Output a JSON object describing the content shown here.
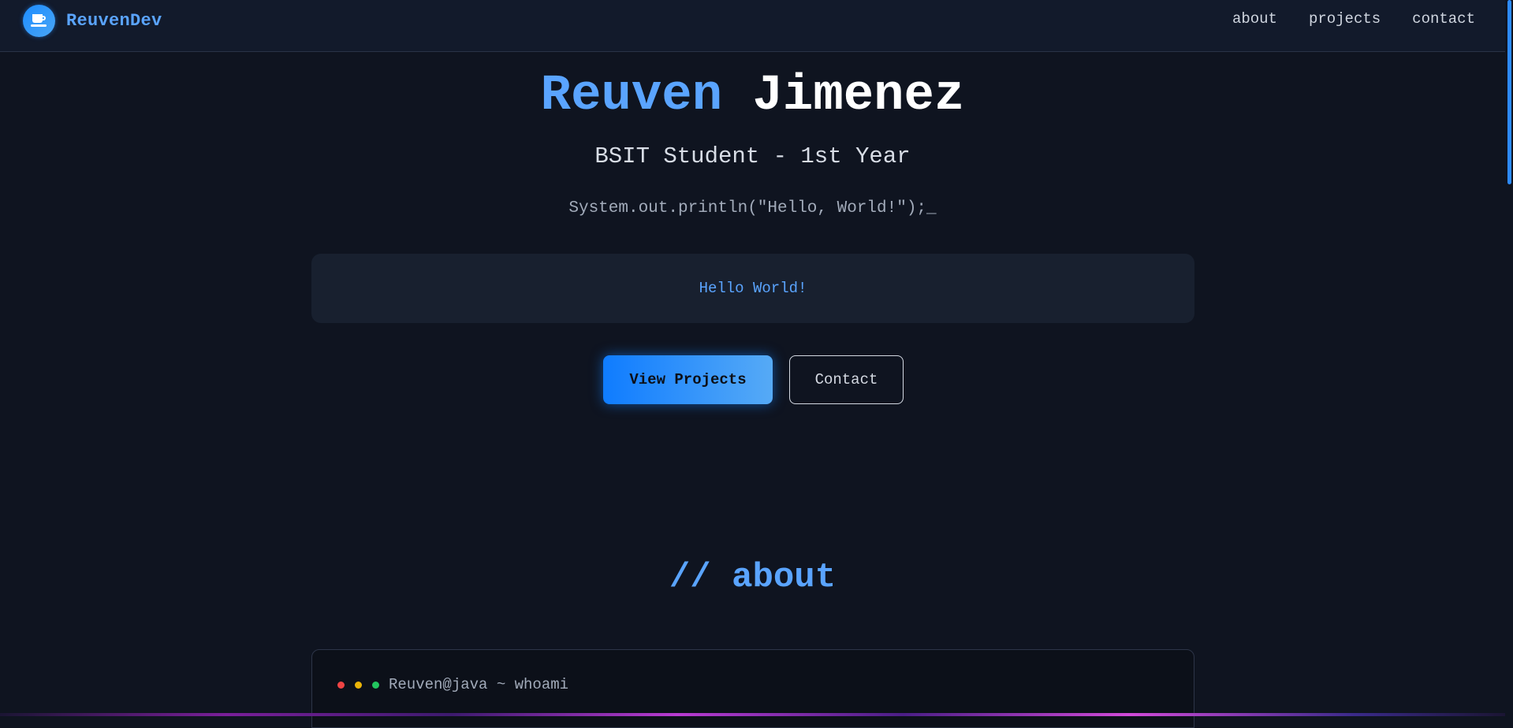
{
  "navbar": {
    "brand": {
      "icon": "coffee-cup-icon",
      "name": "ReuvenDev"
    },
    "links": [
      {
        "label": "about"
      },
      {
        "label": "projects"
      },
      {
        "label": "contact"
      }
    ]
  },
  "hero": {
    "first_name": "Reuven",
    "last_name": "Jimenez",
    "subtitle": "BSIT Student - 1st Year",
    "code_line": "System.out.println(\"Hello, World!\");_",
    "output": "Hello World!",
    "buttons": {
      "primary": "View Projects",
      "secondary": "Contact"
    }
  },
  "about": {
    "title": "// about",
    "terminal": {
      "prompt": "Reuven@java ~ whoami"
    }
  },
  "colors": {
    "background": "#0f1420",
    "accent": "#5aa4ff",
    "primary_button": "#0f7cff"
  }
}
